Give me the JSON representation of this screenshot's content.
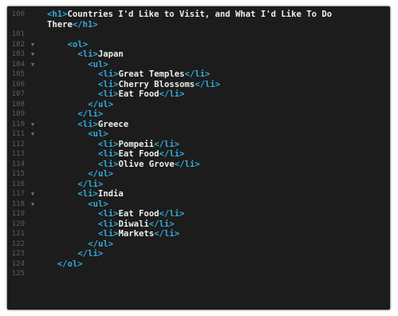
{
  "colors": {
    "background": "#1c1c1c",
    "tag": "#35a9d8",
    "text": "#eeeeee",
    "line_number": "#5a5e63"
  },
  "editor": {
    "lines": [
      {
        "num": "100",
        "fold": "",
        "indent": 0,
        "tokens": [
          {
            "t": "tag",
            "v": "<h1>"
          },
          {
            "t": "txt",
            "v": "Countries I'd Like to Visit, and What I'd Like To Do"
          }
        ]
      },
      {
        "num": "",
        "fold": "",
        "indent": 0,
        "tokens": [
          {
            "t": "txt",
            "v": "There"
          },
          {
            "t": "tag",
            "v": "</h1>"
          }
        ]
      },
      {
        "num": "101",
        "fold": "",
        "indent": 0,
        "tokens": []
      },
      {
        "num": "102",
        "fold": "▼",
        "indent": 4,
        "tokens": [
          {
            "t": "tag",
            "v": "<ol>"
          }
        ]
      },
      {
        "num": "103",
        "fold": "▼",
        "indent": 6,
        "tokens": [
          {
            "t": "tag",
            "v": "<li>"
          },
          {
            "t": "txt",
            "v": "Japan"
          }
        ]
      },
      {
        "num": "104",
        "fold": "▼",
        "indent": 8,
        "tokens": [
          {
            "t": "tag",
            "v": "<ul>"
          }
        ]
      },
      {
        "num": "105",
        "fold": "",
        "indent": 10,
        "tokens": [
          {
            "t": "tag",
            "v": "<li>"
          },
          {
            "t": "txt",
            "v": "Great Temples"
          },
          {
            "t": "tag",
            "v": "</li>"
          }
        ]
      },
      {
        "num": "106",
        "fold": "",
        "indent": 10,
        "tokens": [
          {
            "t": "tag",
            "v": "<li>"
          },
          {
            "t": "txt",
            "v": "Cherry Blossoms"
          },
          {
            "t": "tag",
            "v": "</li>"
          }
        ]
      },
      {
        "num": "107",
        "fold": "",
        "indent": 10,
        "tokens": [
          {
            "t": "tag",
            "v": "<li>"
          },
          {
            "t": "txt",
            "v": "Eat Food"
          },
          {
            "t": "tag",
            "v": "</li>"
          }
        ]
      },
      {
        "num": "108",
        "fold": "",
        "indent": 8,
        "tokens": [
          {
            "t": "tag",
            "v": "</ul>"
          }
        ]
      },
      {
        "num": "109",
        "fold": "",
        "indent": 6,
        "tokens": [
          {
            "t": "tag",
            "v": "</li>"
          }
        ]
      },
      {
        "num": "110",
        "fold": "▼",
        "indent": 6,
        "tokens": [
          {
            "t": "tag",
            "v": "<li>"
          },
          {
            "t": "txt",
            "v": "Greece"
          }
        ]
      },
      {
        "num": "111",
        "fold": "▼",
        "indent": 8,
        "tokens": [
          {
            "t": "tag",
            "v": "<ul>"
          }
        ]
      },
      {
        "num": "112",
        "fold": "",
        "indent": 10,
        "tokens": [
          {
            "t": "tag",
            "v": "<li>"
          },
          {
            "t": "txt",
            "v": "Pompeii"
          },
          {
            "t": "tag",
            "v": "</li>"
          }
        ]
      },
      {
        "num": "113",
        "fold": "",
        "indent": 10,
        "tokens": [
          {
            "t": "tag",
            "v": "<li>"
          },
          {
            "t": "txt",
            "v": "Eat Food"
          },
          {
            "t": "tag",
            "v": "</li>"
          }
        ]
      },
      {
        "num": "114",
        "fold": "",
        "indent": 10,
        "tokens": [
          {
            "t": "tag",
            "v": "<li>"
          },
          {
            "t": "txt",
            "v": "Olive Grove"
          },
          {
            "t": "tag",
            "v": "</li>"
          }
        ]
      },
      {
        "num": "115",
        "fold": "",
        "indent": 8,
        "tokens": [
          {
            "t": "tag",
            "v": "</ul>"
          }
        ]
      },
      {
        "num": "116",
        "fold": "",
        "indent": 6,
        "tokens": [
          {
            "t": "tag",
            "v": "</li>"
          }
        ]
      },
      {
        "num": "117",
        "fold": "▼",
        "indent": 6,
        "tokens": [
          {
            "t": "tag",
            "v": "<li>"
          },
          {
            "t": "txt",
            "v": "India"
          }
        ]
      },
      {
        "num": "118",
        "fold": "▼",
        "indent": 8,
        "tokens": [
          {
            "t": "tag",
            "v": "<ul>"
          }
        ]
      },
      {
        "num": "119",
        "fold": "",
        "indent": 10,
        "tokens": [
          {
            "t": "tag",
            "v": "<li>"
          },
          {
            "t": "txt",
            "v": "Eat Food"
          },
          {
            "t": "tag",
            "v": "</li>"
          }
        ]
      },
      {
        "num": "120",
        "fold": "",
        "indent": 10,
        "tokens": [
          {
            "t": "tag",
            "v": "<li>"
          },
          {
            "t": "txt",
            "v": "Diwali"
          },
          {
            "t": "tag",
            "v": "</li>"
          }
        ]
      },
      {
        "num": "121",
        "fold": "",
        "indent": 10,
        "tokens": [
          {
            "t": "tag",
            "v": "<li>"
          },
          {
            "t": "txt",
            "v": "Markets"
          },
          {
            "t": "tag",
            "v": "</li>"
          }
        ]
      },
      {
        "num": "122",
        "fold": "",
        "indent": 8,
        "tokens": [
          {
            "t": "tag",
            "v": "</ul>"
          }
        ]
      },
      {
        "num": "123",
        "fold": "",
        "indent": 6,
        "tokens": [
          {
            "t": "tag",
            "v": "</li>"
          }
        ]
      },
      {
        "num": "124",
        "fold": "",
        "indent": 2,
        "tokens": [
          {
            "t": "tag",
            "v": "</ol>"
          }
        ]
      },
      {
        "num": "125",
        "fold": "",
        "indent": 0,
        "tokens": []
      }
    ]
  }
}
